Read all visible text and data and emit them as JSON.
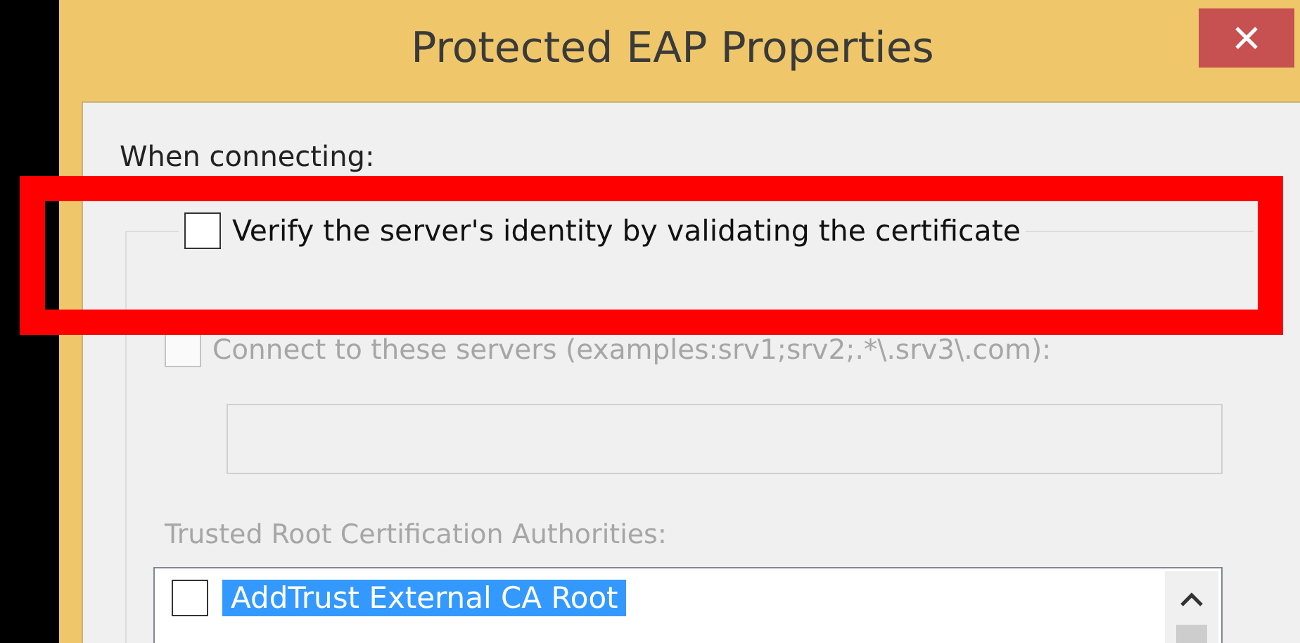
{
  "window": {
    "title": "Protected EAP Properties"
  },
  "when_connecting_label": "When connecting:",
  "verify": {
    "label": "Verify the server's identity by validating the certificate",
    "checked": false
  },
  "connect_servers": {
    "label": "Connect to these servers (examples:srv1;srv2;.*\\.srv3\\.com):",
    "checked": false,
    "disabled": true
  },
  "servers_field": {
    "disabled": true
  },
  "trusted_label": "Trusted Root Certification Authorities:",
  "ca_list": [
    {
      "name": "AddTrust External CA Root",
      "checked": false,
      "selected": true
    }
  ]
}
